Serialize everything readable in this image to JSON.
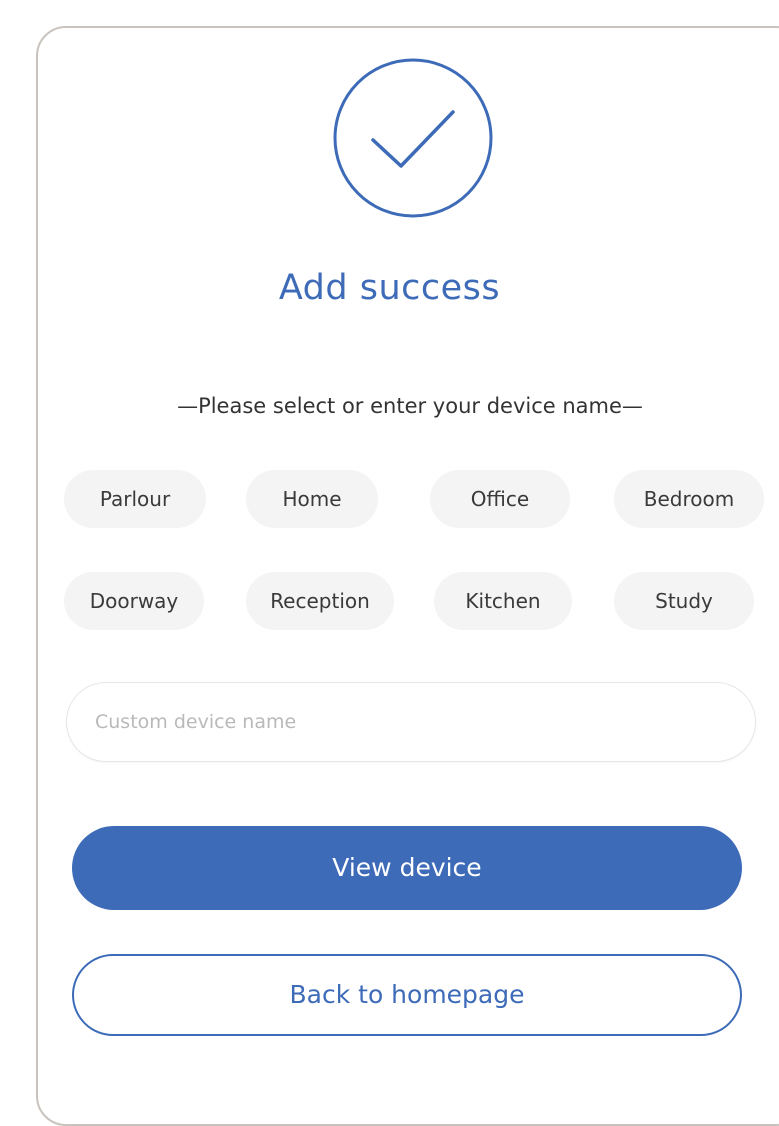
{
  "dialog": {
    "title": "Add success",
    "subtitle": "—Please select or enter your device name—",
    "name_options": [
      "Parlour",
      "Home",
      "Office",
      "Bedroom",
      "Doorway",
      "Reception",
      "Kitchen",
      "Study"
    ],
    "custom_name_input": {
      "value": "",
      "placeholder": "Custom device name"
    },
    "view_device_label": "View device",
    "back_to_homepage_label": "Back to homepage"
  },
  "icons": {
    "status": "checkmark-circle-icon"
  },
  "colors": {
    "accent": "#3d6bb8",
    "chip_background": "#f4f4f4",
    "card_border": "#c9c3bd",
    "text": "#3a3a3a"
  }
}
